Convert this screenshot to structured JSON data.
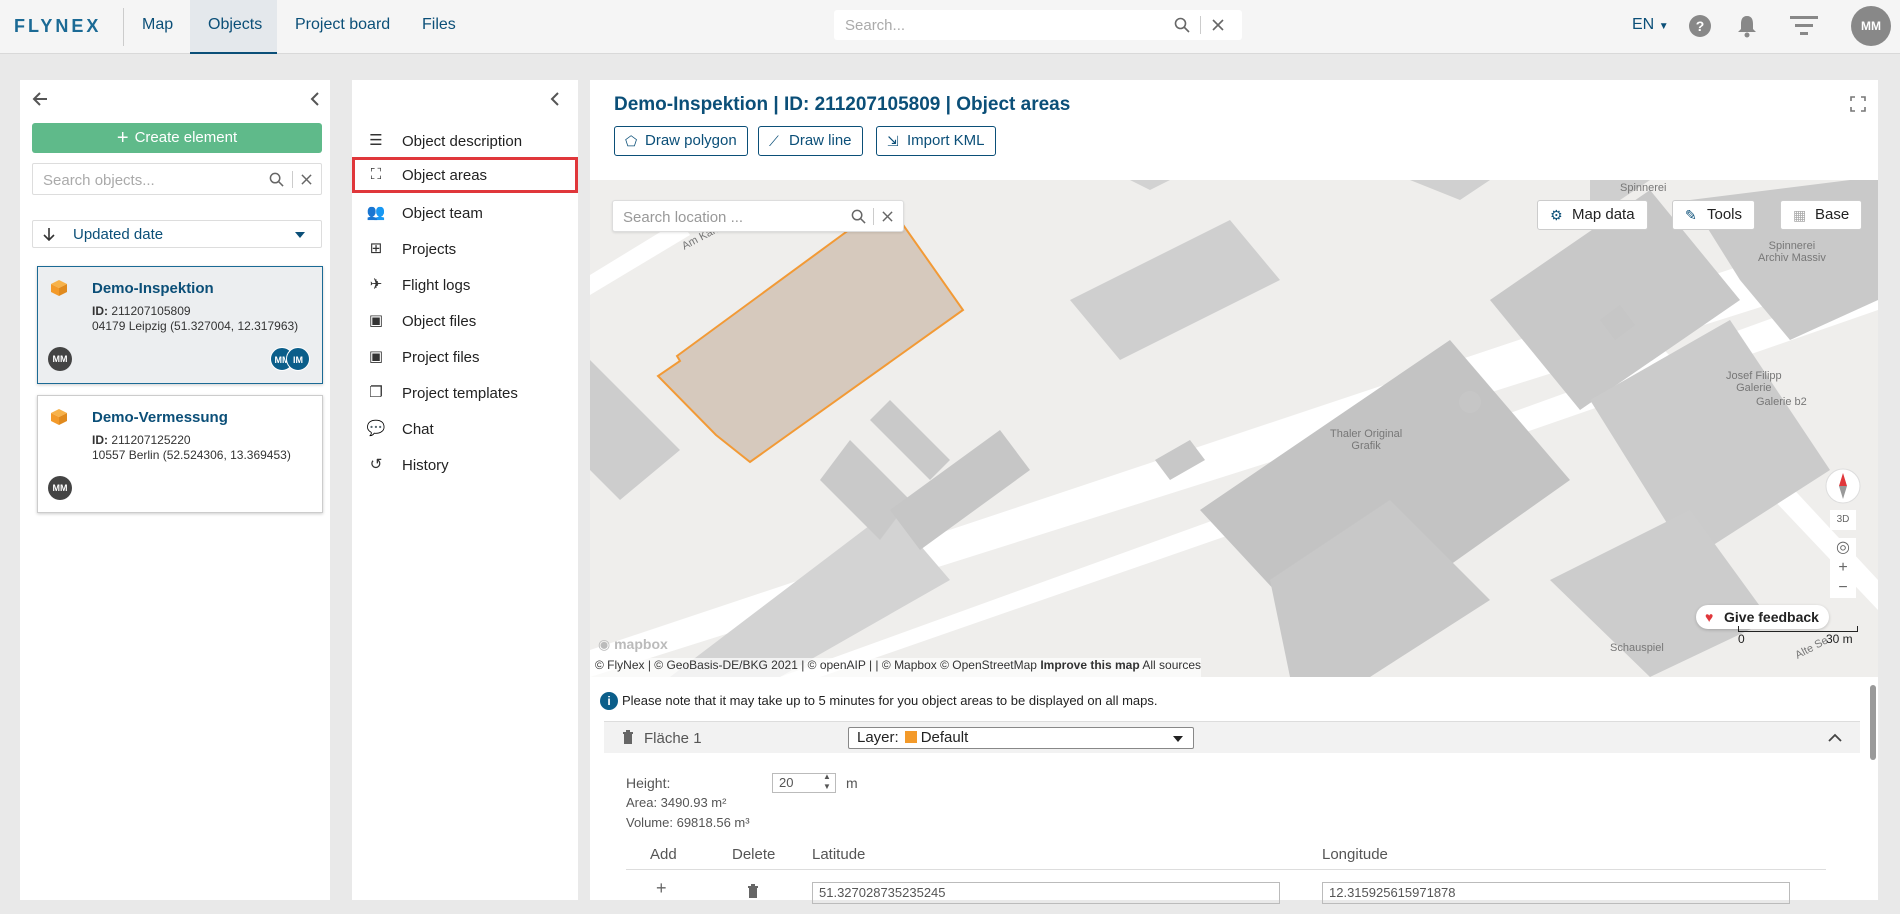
{
  "topnav": {
    "logo": "FLYNEX",
    "tabs": [
      "Map",
      "Objects",
      "Project board",
      "Files"
    ],
    "active_tab": "Objects",
    "search_placeholder": "Search...",
    "language": "EN",
    "help": "?",
    "user_initials": "MM"
  },
  "left": {
    "create_label": "Create element",
    "search_placeholder": "Search objects...",
    "sort_label": "Updated date",
    "objects": [
      {
        "title": "Demo-Inspektion",
        "id_label": "ID:",
        "id": "211207105809",
        "address": "04179 Leipzig (51.327004, 12.317963)",
        "owner": "MM",
        "members": [
          "MM",
          "IM"
        ]
      },
      {
        "title": "Demo-Vermessung",
        "id_label": "ID:",
        "id": "211207125220",
        "address": "10557 Berlin (52.524306, 13.369453)",
        "owner": "MM",
        "members": []
      }
    ]
  },
  "menu": {
    "items": [
      {
        "label": "Object description",
        "icon": "list-icon"
      },
      {
        "label": "Object areas",
        "icon": "area-icon"
      },
      {
        "label": "Object team",
        "icon": "team-icon"
      },
      {
        "label": "Projects",
        "icon": "projects-icon"
      },
      {
        "label": "Flight logs",
        "icon": "plane-icon"
      },
      {
        "label": "Object files",
        "icon": "folder-icon"
      },
      {
        "label": "Project files",
        "icon": "folder-icon"
      },
      {
        "label": "Project templates",
        "icon": "template-icon"
      },
      {
        "label": "Chat",
        "icon": "chat-icon"
      },
      {
        "label": "History",
        "icon": "history-icon"
      }
    ],
    "highlighted": "Object areas"
  },
  "main": {
    "title": "Demo-Inspektion | ID: 211207105809 | Object areas",
    "draw_polygon": "Draw polygon",
    "draw_line": "Draw line",
    "import_kml": "Import KML"
  },
  "map": {
    "search_placeholder": "Search location ...",
    "map_data": "Map data",
    "tools": "Tools",
    "base": "Base",
    "labels": {
      "am_kanal": "Am Kanal",
      "spinnerei": "Spinnerei",
      "spinnerei_archiv_1": "Spinnerei",
      "spinnerei_archiv_2": "Archiv Massiv",
      "josef_1": "Josef Filipp",
      "josef_2": "Galerie",
      "galerie_b2": "Galerie b2",
      "thaler_1": "Thaler Original",
      "thaler_2": "Grafik",
      "schauspiel": "Schauspiel",
      "alte_se": "Alte Se"
    },
    "mapbox_logo": "mapbox",
    "attribution_prefix": "© FlyNex | © GeoBasis-DE/BKG 2021 | © openAIP | | © Mapbox © OpenStreetMap",
    "improve": "Improve this map",
    "all_sources": "All sources",
    "feedback": "Give feedback",
    "three_d": "3D",
    "scale_min": "0",
    "scale_max": "30 m",
    "polygon_fill": "#d6c9bd",
    "polygon_stroke": "#f29a36"
  },
  "details": {
    "note": "Please note that it may take up to 5 minutes for you object areas to be displayed on all maps.",
    "area_name": "Fläche 1",
    "layer_label": "Layer:",
    "layer_value": "Default",
    "layer_color": "#f39a2a",
    "height_label": "Height:",
    "height_value": "20",
    "height_unit": "m",
    "area_text": "Area: 3490.93 m²",
    "volume_text": "Volume: 69818.56 m³",
    "col_add": "Add",
    "col_delete": "Delete",
    "col_lat": "Latitude",
    "col_lon": "Longitude",
    "row1_lat": "51.327028735235245",
    "row1_lon": "12.315925615971878"
  }
}
